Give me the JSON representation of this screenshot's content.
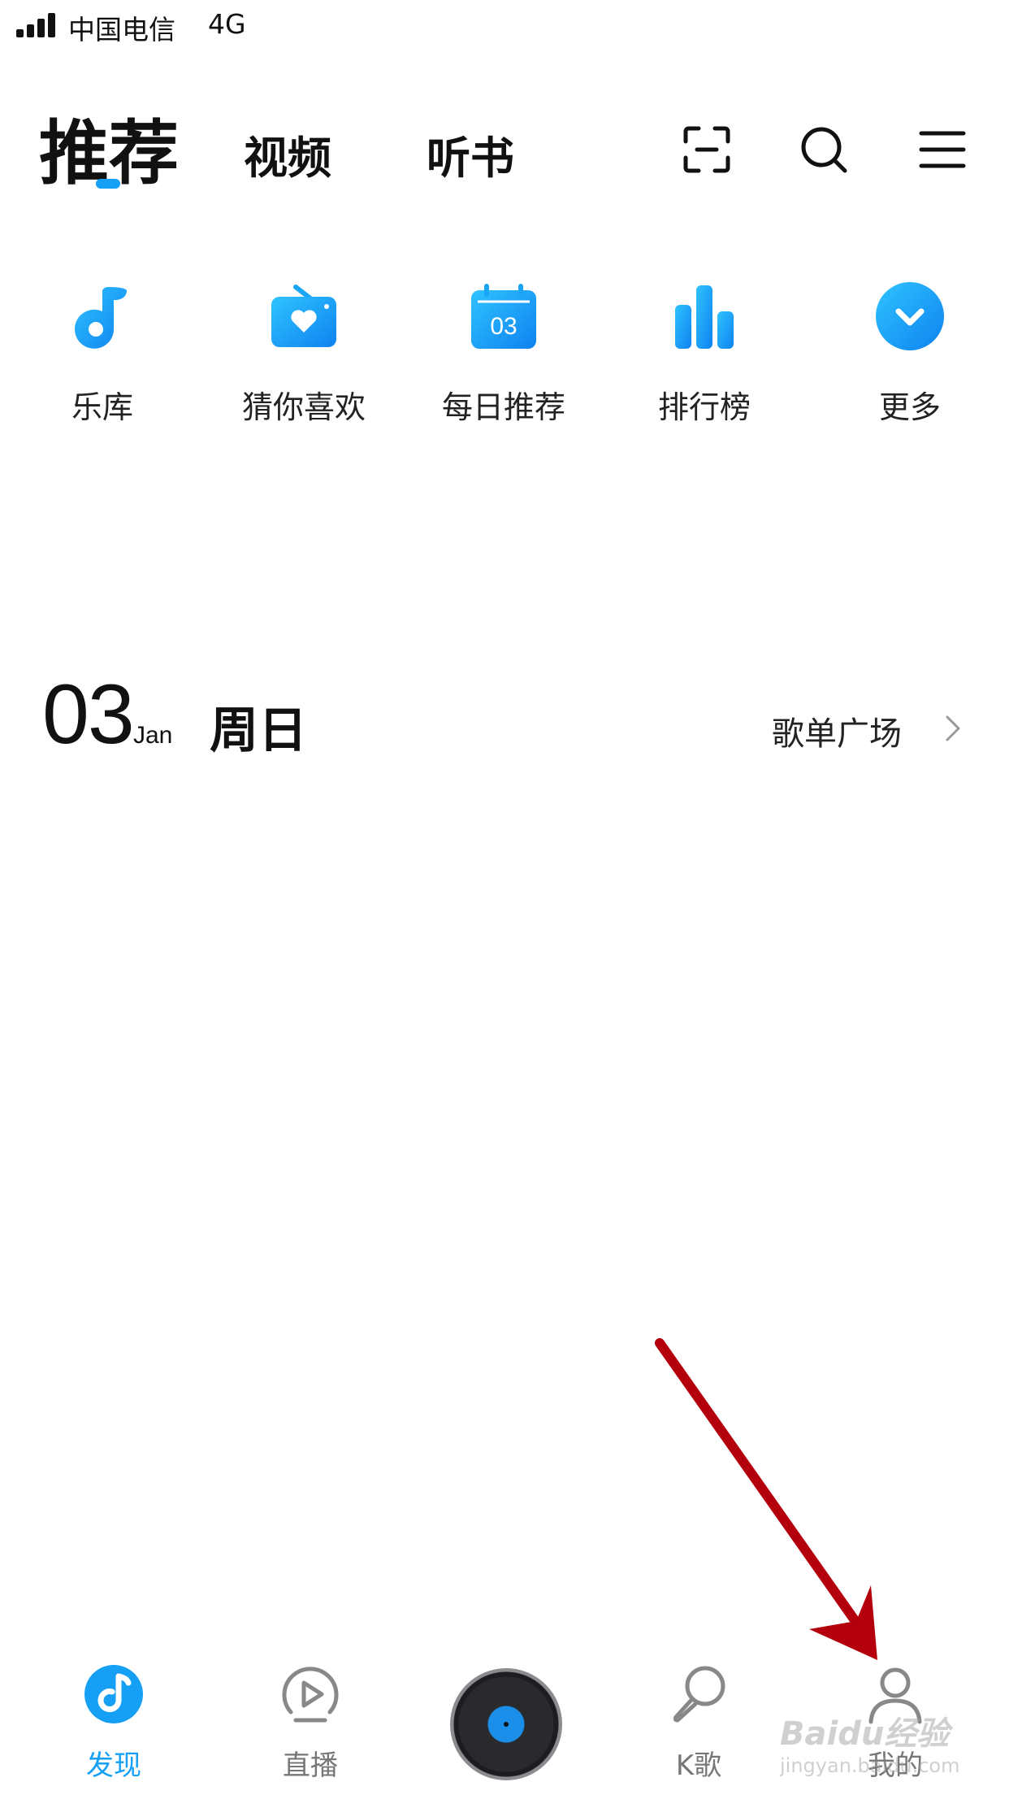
{
  "status_bar": {
    "carrier": "中国电信",
    "network": "4G"
  },
  "top_nav": {
    "tabs": [
      {
        "label": "推荐",
        "active": true
      },
      {
        "label": "视频",
        "active": false
      },
      {
        "label": "听书",
        "active": false
      }
    ],
    "icons": [
      "scan-icon",
      "search-icon",
      "menu-icon"
    ]
  },
  "quick_entries": [
    {
      "label": "乐库",
      "icon": "music-note-icon"
    },
    {
      "label": "猜你喜欢",
      "icon": "radio-heart-icon"
    },
    {
      "label": "每日推荐",
      "icon": "calendar-icon",
      "icon_text": "03"
    },
    {
      "label": "排行榜",
      "icon": "chart-bars-icon"
    },
    {
      "label": "更多",
      "icon": "chevron-down-circle-icon"
    }
  ],
  "date_header": {
    "day": "03",
    "month": "Jan",
    "weekday": "周日",
    "link": "歌单广场"
  },
  "bottom_nav": [
    {
      "label": "发现",
      "icon": "discover-icon",
      "active": true
    },
    {
      "label": "直播",
      "icon": "live-play-icon",
      "active": false
    },
    {
      "label": "",
      "icon": "now-playing-disc-icon",
      "active": false
    },
    {
      "label": "K歌",
      "icon": "microphone-icon",
      "active": false
    },
    {
      "label": "我的",
      "icon": "profile-icon",
      "active": false
    }
  ],
  "watermark": {
    "line1": "Baidu经验",
    "line2": "jingyan.baidu.com"
  },
  "colors": {
    "accent": "#15a0f5",
    "annotation_arrow": "#b3000c",
    "text": "#111111"
  }
}
